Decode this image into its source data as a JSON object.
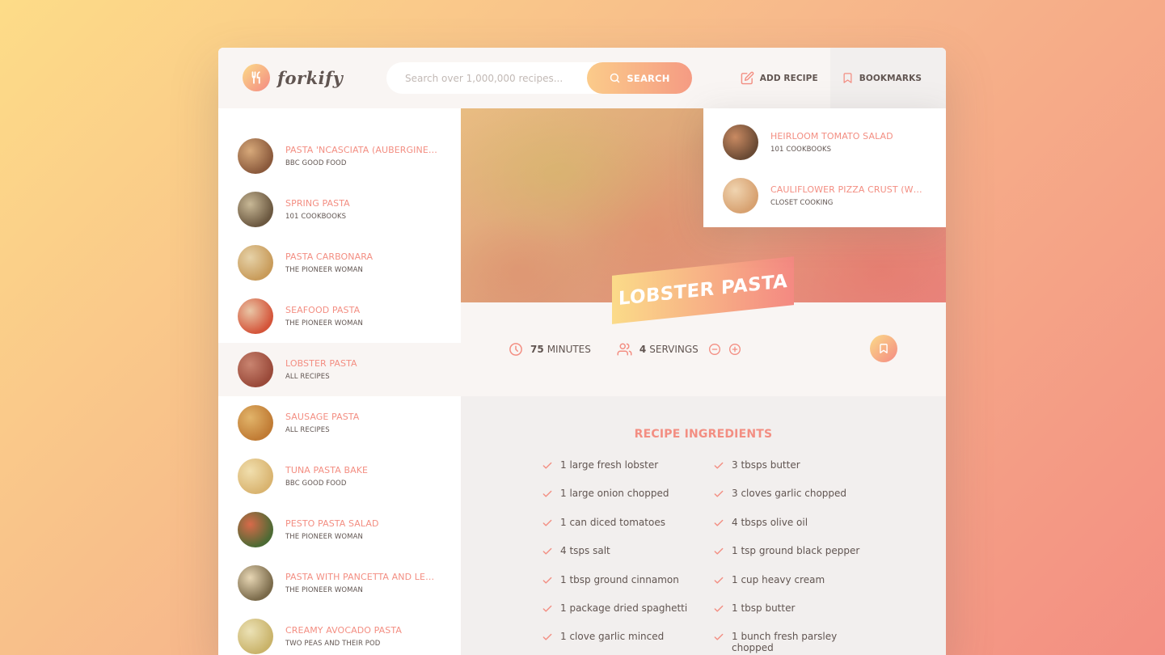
{
  "app": {
    "logo_text": "forkify"
  },
  "search": {
    "placeholder": "Search over 1,000,000 recipes...",
    "button_label": "SEARCH"
  },
  "nav": {
    "add_recipe": "ADD RECIPE",
    "bookmarks": "BOOKMARKS"
  },
  "results": [
    {
      "title": "Pasta 'ncasciata (aubergine ...",
      "publisher": "BBC Good Food",
      "thumb": [
        "#8b5a3c",
        "#d7a97a"
      ]
    },
    {
      "title": "Spring Pasta",
      "publisher": "101 Cookbooks",
      "thumb": [
        "#6b5840",
        "#c8b896"
      ]
    },
    {
      "title": "Pasta Carbonara",
      "publisher": "The Pioneer Woman",
      "thumb": [
        "#c89b5a",
        "#e6d2a8"
      ]
    },
    {
      "title": "Seafood Pasta",
      "publisher": "The Pioneer Woman",
      "thumb": [
        "#d4553a",
        "#e9c6a6"
      ]
    },
    {
      "title": "Lobster Pasta",
      "publisher": "All Recipes",
      "thumb": [
        "#9a4a3a",
        "#c98470"
      ]
    },
    {
      "title": "Sausage Pasta",
      "publisher": "All Recipes",
      "thumb": [
        "#c07b34",
        "#e2b46a"
      ]
    },
    {
      "title": "Tuna Pasta Bake",
      "publisher": "BBC Good Food",
      "thumb": [
        "#d9b470",
        "#f1dfae"
      ]
    },
    {
      "title": "Pesto Pasta Salad",
      "publisher": "The Pioneer Woman",
      "thumb": [
        "#4c6a34",
        "#d86a4a"
      ]
    },
    {
      "title": "Pasta with Pancetta and Lee...",
      "publisher": "The Pioneer Woman",
      "thumb": [
        "#7a6a4a",
        "#e7d6b4"
      ]
    },
    {
      "title": "Creamy Avocado Pasta",
      "publisher": "Two Peas and Their Pod",
      "thumb": [
        "#c9b36a",
        "#ece2b6"
      ]
    }
  ],
  "active_result_index": 4,
  "bookmarks": [
    {
      "title": "Heirloom Tomato Salad",
      "publisher": "101 Cookbooks",
      "thumb": [
        "#6a4a34",
        "#c98a62"
      ]
    },
    {
      "title": "Cauliflower Pizza Crust (wit...",
      "publisher": "Closet Cooking",
      "thumb": [
        "#d7a170",
        "#f0d4b0"
      ]
    }
  ],
  "recipe": {
    "title": "Lobster Pasta",
    "cooking_time": "75",
    "cooking_time_unit": "minutes",
    "servings": "4",
    "servings_unit": "servings",
    "ingredients_heading": "Recipe ingredients",
    "ingredients": [
      "1 large fresh lobster",
      "1 large onion chopped",
      "1 can diced tomatoes",
      "4 tsps salt",
      "1 tbsp ground cinnamon",
      "1 package dried spaghetti",
      "1 clove garlic minced",
      "3 tbsps butter",
      "3 cloves garlic chopped",
      "4 tbsps olive oil",
      "1 tsp ground black pepper",
      "1 cup heavy cream",
      "1 tbsp butter",
      "1 bunch fresh parsley chopped"
    ]
  },
  "colors": {
    "accent": "#f38e82",
    "gradient_start": "#fbdb89",
    "gradient_end": "#f48982",
    "text": "#615551"
  }
}
